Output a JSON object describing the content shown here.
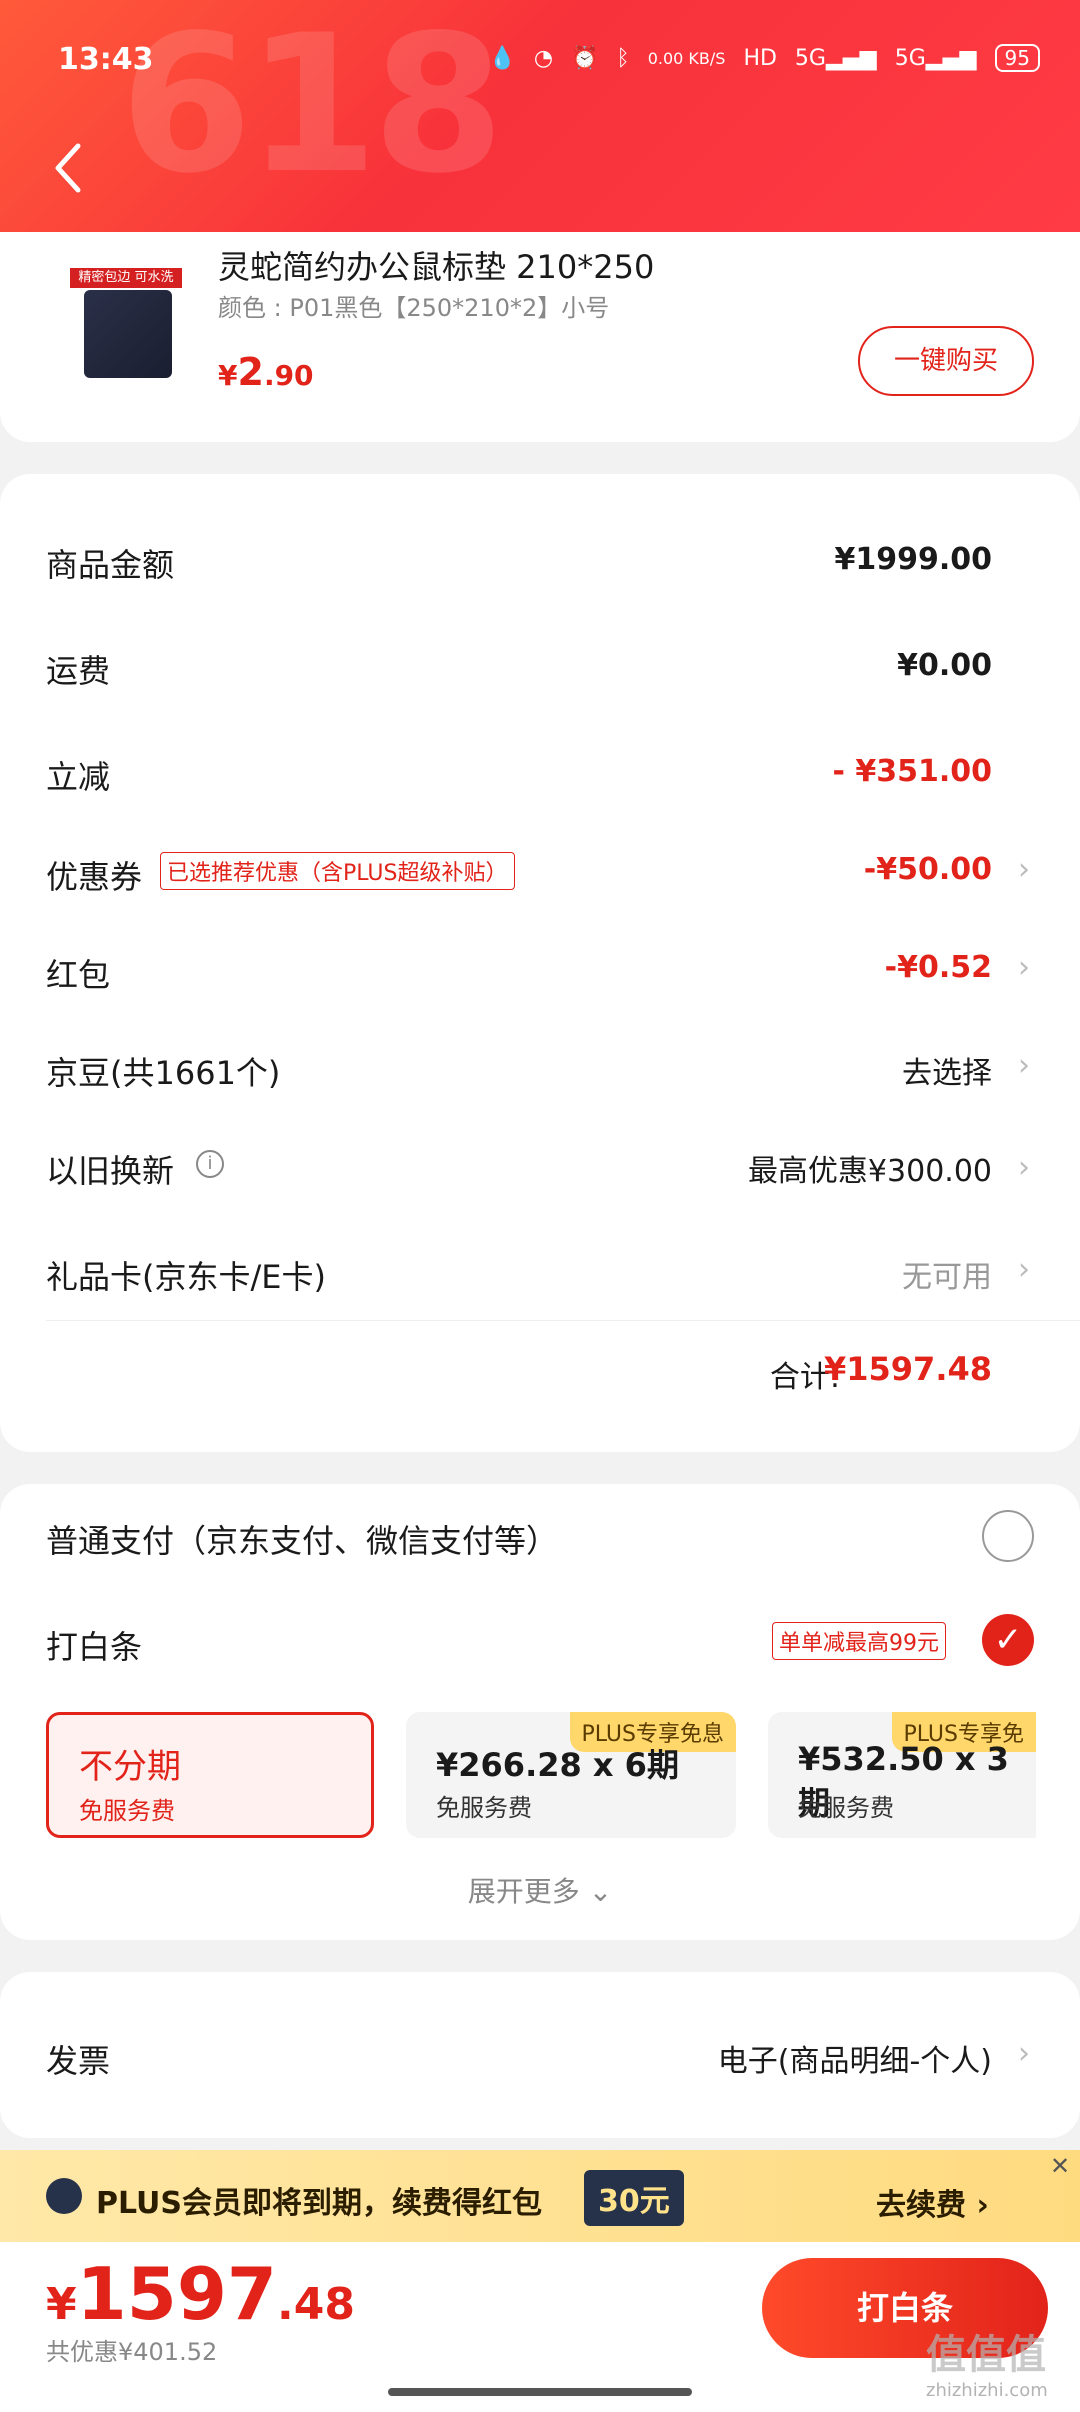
{
  "status_bar": {
    "time": "13:43",
    "net_speed": "0.00 KB/S",
    "battery": "95"
  },
  "header": {
    "bg_text": "618"
  },
  "product": {
    "thumb_tag": "精密包边 可水洗",
    "title": "灵蛇简约办公鼠标垫  210*250",
    "spec": "颜色 : P01黑色【250*210*2】小号",
    "price_currency": "¥",
    "price_int": "2",
    "price_dec": ".90",
    "buy_now": "一键购买"
  },
  "summary": {
    "rows": [
      {
        "label": "商品金额",
        "value": "¥1999.00"
      },
      {
        "label": "运费",
        "value": "¥0.00"
      },
      {
        "label": "立减",
        "value": "- ¥351.00"
      },
      {
        "label": "优惠券",
        "value": "-¥50.00",
        "tag": "已选推荐优惠（含PLUS超级补贴）"
      },
      {
        "label": "红包",
        "value": "-¥0.52"
      },
      {
        "label": "京豆(共1661个)",
        "value": "去选择"
      },
      {
        "label": "以旧换新",
        "value": "最高优惠¥300.00"
      },
      {
        "label": "礼品卡(京东卡/E卡)",
        "value": "无可用"
      }
    ],
    "total_label": "合计:",
    "total_value": "¥1597.48"
  },
  "payment": {
    "normal_label": "普通支付（京东支付、微信支付等）",
    "baitiao_label": "打白条",
    "baitiao_promo": "单单减最高99元",
    "installments": [
      {
        "title": "不分期",
        "sub": "免服务费"
      },
      {
        "title": "¥266.28 x 6期",
        "sub": "免服务费",
        "badge": "PLUS专享免息"
      },
      {
        "title": "¥532.50 x 3期",
        "sub": "免服务费",
        "badge": "PLUS专享免"
      }
    ],
    "expand_more": "展开更多"
  },
  "invoice": {
    "label": "发票",
    "value": "电子(商品明细-个人)"
  },
  "plus_banner": {
    "text": "PLUS会员即将到期，续费得红包",
    "amount": "30元",
    "renew": "去续费"
  },
  "bottom": {
    "price_currency": "¥",
    "price_int": "1597",
    "price_dec": ".48",
    "saved": "共优惠¥401.52",
    "pay_button": "打白条"
  },
  "watermark": {
    "text": "值值值",
    "sub": "zhizhizhi.com"
  },
  "colors": {
    "accent": "#e2231a",
    "header": "#f8323a",
    "plus_gold": "#ffdb80"
  }
}
